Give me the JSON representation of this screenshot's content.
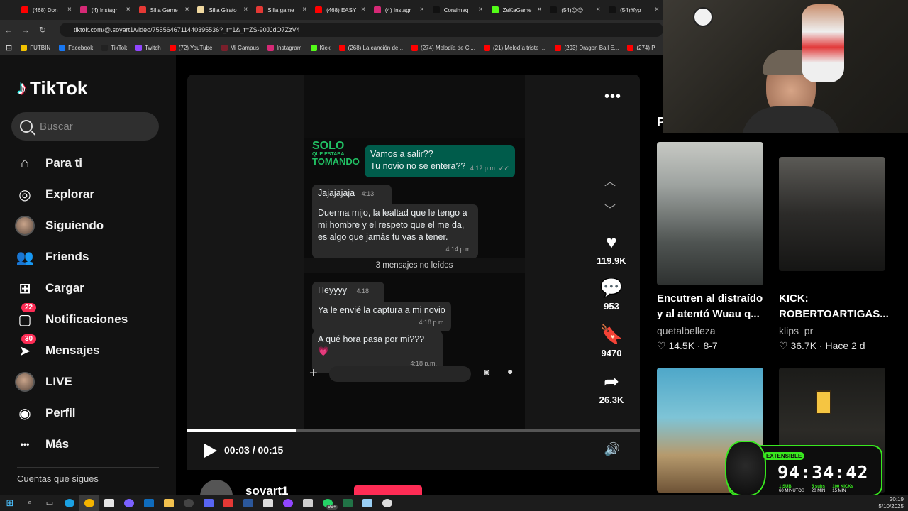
{
  "browser": {
    "tabs": [
      {
        "label": "(468) Don",
        "color": "#ff0000"
      },
      {
        "label": "(4) Instagr",
        "color": "#d62976"
      },
      {
        "label": "Silla Game",
        "color": "#e53935"
      },
      {
        "label": "Silla Girato",
        "color": "#f0d9a0"
      },
      {
        "label": "Silla game",
        "color": "#e53935"
      },
      {
        "label": "(468) EASY",
        "color": "#ff0000"
      },
      {
        "label": "(4) Instagr",
        "color": "#d62976"
      },
      {
        "label": "Coraimaq",
        "color": "#111111"
      },
      {
        "label": "ZeKaGame",
        "color": "#53fc18"
      },
      {
        "label": "(54)😉😉",
        "color": "#111111"
      },
      {
        "label": "(54)#fyp",
        "color": "#111111"
      }
    ],
    "url": "tiktok.com/@.soyart1/video/7555646711440395536?_r=1&_t=ZS-90JJdO7ZzV4",
    "bookmarks": [
      {
        "label": "FUTBIN",
        "color": "#f2c200"
      },
      {
        "label": "Facebook",
        "color": "#1877f2"
      },
      {
        "label": "TikTok",
        "color": "#222222"
      },
      {
        "label": "Twitch",
        "color": "#9146ff"
      },
      {
        "label": "(72) YouTube",
        "color": "#ff0000"
      },
      {
        "label": "Mi Campus",
        "color": "#7a1f2b"
      },
      {
        "label": "Instagram",
        "color": "#d62976"
      },
      {
        "label": "Kick",
        "color": "#53fc18"
      },
      {
        "label": "(268) La canción de...",
        "color": "#ff0000"
      },
      {
        "label": "(274) Melodía de Cl...",
        "color": "#ff0000"
      },
      {
        "label": "(21) Melodía triste |...",
        "color": "#ff0000"
      },
      {
        "label": "(293) Dragon Ball E...",
        "color": "#ff0000"
      },
      {
        "label": "(274) P",
        "color": "#ff0000"
      }
    ]
  },
  "sidebar": {
    "logo": "TikTok",
    "search_placeholder": "Buscar",
    "items": [
      {
        "label": "Para ti",
        "icon": "home-icon"
      },
      {
        "label": "Explorar",
        "icon": "compass-icon"
      },
      {
        "label": "Siguiendo",
        "icon": "avatar"
      },
      {
        "label": "Friends",
        "icon": "friends-icon"
      },
      {
        "label": "Cargar",
        "icon": "upload-icon"
      },
      {
        "label": "Notificaciones",
        "icon": "inbox-icon",
        "badge": "22"
      },
      {
        "label": "Mensajes",
        "icon": "send-icon",
        "badge": "30"
      },
      {
        "label": "LIVE",
        "icon": "avatar"
      },
      {
        "label": "Perfil",
        "icon": "profile-icon"
      },
      {
        "label": "Más",
        "icon": "more-icon"
      }
    ],
    "following_heading": "Cuentas que sigues"
  },
  "video": {
    "promo_line1": "SOLO",
    "promo_line2": "QUE ESTABA",
    "promo_line3": "TOMANDO",
    "messages": [
      {
        "text": "Vamos a salir??\nTu novio no se entera??",
        "time": "4:12 p.m."
      },
      {
        "text": "Jajajajaja",
        "time": "4:13 p.m."
      },
      {
        "text": "Duerma mijo, la lealtad que le tengo a mi hombre y el respeto que el me da, es algo que jamás tu vas a tener.",
        "time": "4:14 p.m."
      },
      {
        "text": "Heyyyy",
        "time": "4:18 p.m."
      },
      {
        "text": "Ya le envié la captura a mi novio",
        "time": "4:18 p.m."
      },
      {
        "text": "A qué hora pasa por mi??? 💗",
        "time": "4:18 p.m."
      }
    ],
    "unread_label": "3 mensajes no leídos",
    "likes": "119.9K",
    "comments": "953",
    "saves": "9470",
    "shares": "26.3K",
    "progress": 0.24,
    "time": "00:03 / 00:15",
    "author": "soyart1"
  },
  "right_column": {
    "heading": "P",
    "videos": [
      {
        "caption": "Encutren al distraído y al atentó Wuau q...",
        "user": "quetalbelleza",
        "stat": "♡ 14.5K · 8-7"
      },
      {
        "caption": "KICK: ROBERTOARTIGAS...",
        "user": "klips_pr",
        "stat": "♡ 36.7K · Hace 2 d"
      }
    ]
  },
  "timer": {
    "label": "EXTENSIBLE",
    "clock": "94:34:42",
    "stat1": "1 SUB",
    "stat1b": "60 MINUTOS",
    "stat2": "5 subs",
    "stat2b": "20 MIN",
    "stat3": "100 KICKs",
    "stat3b": "15 MIN"
  },
  "taskbar": {
    "time": "20:19",
    "date": "5/10/2025",
    "badge": "99+"
  }
}
